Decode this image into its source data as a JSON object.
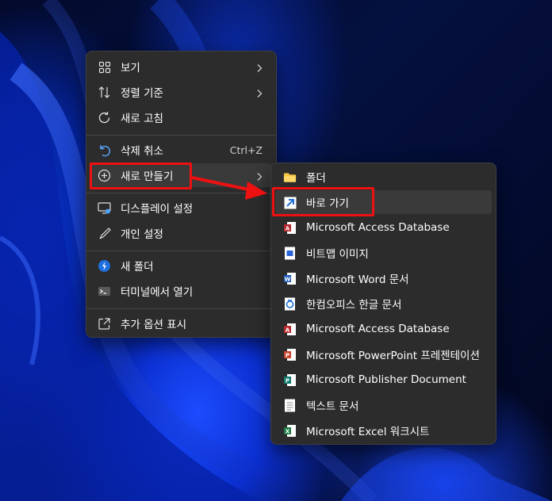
{
  "context_menu": {
    "items": [
      {
        "label": "보기",
        "icon": "grid-view-icon",
        "submenu": true
      },
      {
        "label": "정렬 기준",
        "icon": "sort-arrows-icon",
        "submenu": true
      },
      {
        "label": "새로 고침",
        "icon": "refresh-icon"
      },
      {
        "label": "삭제 취소",
        "icon": "undo-icon",
        "shortcut": "Ctrl+Z"
      },
      {
        "label": "새로 만들기",
        "icon": "plus-circle-icon",
        "submenu": true
      },
      {
        "label": "디스플레이 설정",
        "icon": "display-settings-icon"
      },
      {
        "label": "개인 설정",
        "icon": "pen-brush-icon"
      },
      {
        "label": "새 폴더",
        "icon": "new-folder-icon"
      },
      {
        "label": "터미널에서 열기",
        "icon": "terminal-icon"
      },
      {
        "label": "추가 옵션 표시",
        "icon": "external-link-icon"
      }
    ]
  },
  "new_submenu": {
    "items": [
      {
        "label": "폴더",
        "icon": "folder-icon"
      },
      {
        "label": "바로 가기",
        "icon": "shortcut-arrow-icon"
      },
      {
        "label": "Microsoft Access Database",
        "icon": "access-icon"
      },
      {
        "label": "비트맵 이미지",
        "icon": "bitmap-icon"
      },
      {
        "label": "Microsoft Word 문서",
        "icon": "word-icon"
      },
      {
        "label": "한컴오피스 한글 문서",
        "icon": "hwp-icon"
      },
      {
        "label": "Microsoft Access Database",
        "icon": "access-icon"
      },
      {
        "label": "Microsoft PowerPoint 프레젠테이션",
        "icon": "powerpoint-icon"
      },
      {
        "label": "Microsoft Publisher Document",
        "icon": "publisher-icon"
      },
      {
        "label": "텍스트 문서",
        "icon": "text-document-icon"
      },
      {
        "label": "Microsoft Excel 워크시트",
        "icon": "excel-icon"
      }
    ]
  },
  "colors": {
    "menu_bg": "#2c2c2c",
    "hover": "#3a3a3a",
    "highlight_box": "#ee1111",
    "accent_blue": "#4aa3ff"
  }
}
